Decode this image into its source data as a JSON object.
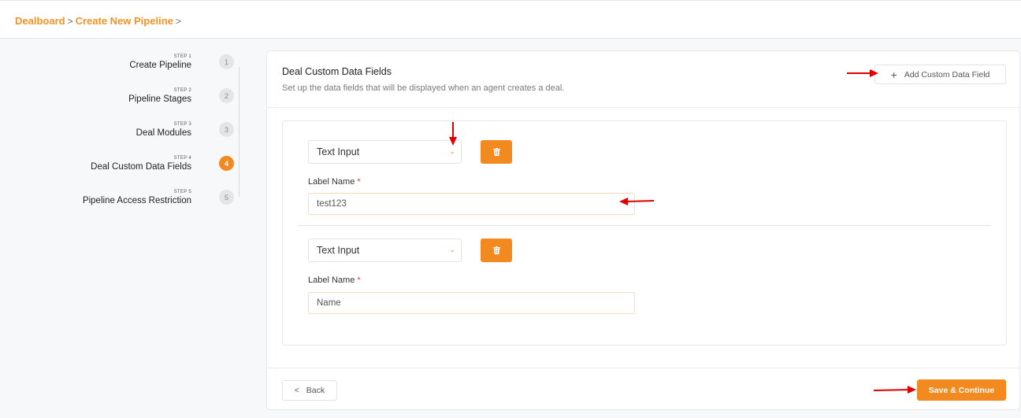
{
  "breadcrumb": {
    "items": [
      "Dealboard",
      "Create New Pipeline"
    ],
    "separator": ">"
  },
  "stepper": {
    "steps": [
      {
        "step_label": "STEP 1",
        "title": "Create Pipeline",
        "number": "1",
        "state": "done"
      },
      {
        "step_label": "STEP 2",
        "title": "Pipeline Stages",
        "number": "2",
        "state": "done"
      },
      {
        "step_label": "STEP 3",
        "title": "Deal Modules",
        "number": "3",
        "state": "done"
      },
      {
        "step_label": "STEP 4",
        "title": "Deal Custom Data Fields",
        "number": "4",
        "state": "active"
      },
      {
        "step_label": "STEP 5",
        "title": "Pipeline Access Restriction",
        "number": "5",
        "state": "pending"
      }
    ]
  },
  "card": {
    "title": "Deal Custom Data Fields",
    "subtitle": "Set up the data fields that will be displayed when an agent creates a deal.",
    "add_button_label": "Add Custom Data Field",
    "add_button_icon": "plus-icon"
  },
  "fields": [
    {
      "type_value": "Text Input",
      "label": "Label Name",
      "required_mark": "*",
      "value": "test123",
      "delete_icon": "trash-icon"
    },
    {
      "type_value": "Text Input",
      "label": "Label Name",
      "required_mark": "*",
      "value": "Name",
      "delete_icon": "trash-icon"
    }
  ],
  "footer": {
    "back_label": "Back",
    "save_label": "Save & Continue"
  },
  "colors": {
    "accent": "#f28a1f",
    "breadcrumb": "#f39327",
    "annotation_arrow": "#e00000"
  }
}
